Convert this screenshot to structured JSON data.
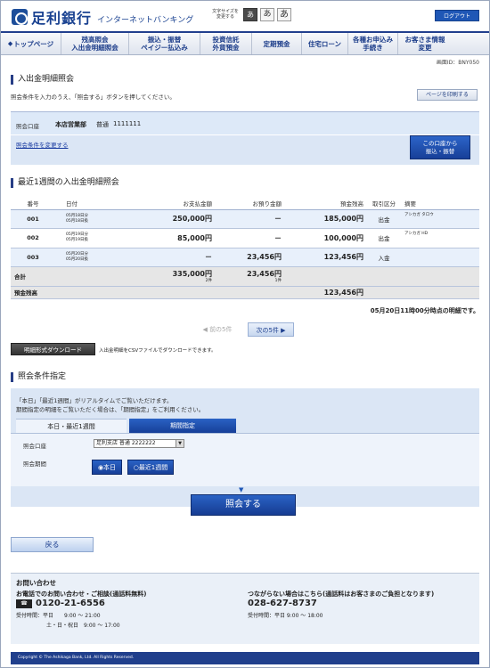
{
  "header": {
    "bank_name": "足利銀行",
    "service_name": "インターネットバンキング",
    "font_size_label": "文字サイズを変更する",
    "font_sizes": [
      "あ",
      "あ",
      "あ"
    ],
    "logout_label": "ログアウト"
  },
  "nav": [
    {
      "label": "トップページ"
    },
    {
      "label": "残高照会\n入出金明細照会"
    },
    {
      "label": "振込・振替\nペイジー払込み"
    },
    {
      "label": "投資信託\n外貨預金"
    },
    {
      "label": "定期預金"
    },
    {
      "label": "住宅ローン"
    },
    {
      "label": "各種お申込み\n手続き"
    },
    {
      "label": "お客さま情報\n変更"
    }
  ],
  "screen_id": "画面ID：BNY050",
  "page_title": "入出金明細照会",
  "instruction": "照会条件を入力のうえ、「照会する」ボタンを押してください。",
  "print_label": "ページを印刷する",
  "account": {
    "label": "照会口座",
    "branch": "本店営業部",
    "type": "普通",
    "number": "1111111",
    "change_link": "照会条件を変更する",
    "transfer_btn": "この口座から\n振込・振替"
  },
  "table": {
    "title": "最近1週間の入出金明細照会",
    "headers": [
      "番号",
      "日付",
      "お支払金額",
      "お預り金額",
      "預金残高",
      "取引区分",
      "摘要"
    ],
    "rows": [
      {
        "no": "001",
        "date1": "05月18日分",
        "date2": "05月18日扱",
        "pay": "250,000円",
        "dep": "－",
        "bal": "185,000円",
        "kind": "出金",
        "memo": "アシカガ タロウ"
      },
      {
        "no": "002",
        "date1": "05月19日分",
        "date2": "05月19日扱",
        "pay": "85,000円",
        "dep": "－",
        "bal": "100,000円",
        "kind": "出金",
        "memo": "アシカガ HD"
      },
      {
        "no": "003",
        "date1": "05月20日分",
        "date2": "05月20日扱",
        "pay": "－",
        "dep": "23,456円",
        "bal": "123,456円",
        "kind": "入金",
        "memo": ""
      }
    ],
    "total_label": "合計",
    "total_pay": "335,000円",
    "total_pay_count": "2件",
    "total_dep": "23,456円",
    "total_dep_count": "1件",
    "balance_label": "預金残高",
    "balance_value": "123,456円",
    "as_of": "05月20日11時00分時点の明細です。"
  },
  "pager": {
    "prev": "前の5件",
    "next": "次の5件"
  },
  "download": {
    "label": "明細形式ダウンロード",
    "note": "入出金明細をCSVファイルでダウンロードできます。"
  },
  "conditions": {
    "title": "照会条件指定",
    "note1": "「本日」「最近1週間」がリアルタイムでご覧いただけます。",
    "note2": "期間指定の明細をご覧いただく場合は、「期間指定」をご利用ください。",
    "tab1": "本日・最近1週間",
    "tab2": "期間指定",
    "account_label": "照会口座",
    "account_value": "足利支店 普通 2222222",
    "period_label": "照会期間",
    "opt_today": "本日",
    "opt_week": "最近1週間",
    "submit": "照会する"
  },
  "back_label": "戻る",
  "contact": {
    "title": "お問い合わせ",
    "phone_title": "お電話でのお問い合わせ・ご相談(通話料無料)",
    "phone": "0120-21-6556",
    "hours1": "受付時間：平日　　9:00 ～ 21:00",
    "hours2": "土・日・祝日　9:00 ～ 17:00",
    "alt_title": "つながらない場合はこちら(通話料はお客さまのご負担となります)",
    "alt_phone": "028-627-8737",
    "alt_hours": "受付時間：平日 9:00 ～ 18:00"
  },
  "footer": "Copyright © The Ashikaga Bank, Ltd. All Rights Reserved."
}
